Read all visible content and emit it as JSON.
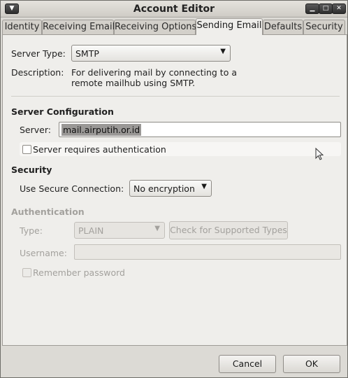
{
  "window": {
    "title": "Account Editor"
  },
  "tabs": [
    {
      "label": "Identity",
      "active": false
    },
    {
      "label": "Receiving Email",
      "active": false
    },
    {
      "label": "Receiving Options",
      "active": false
    },
    {
      "label": "Sending Email",
      "active": true
    },
    {
      "label": "Defaults",
      "active": false
    },
    {
      "label": "Security",
      "active": false
    }
  ],
  "server_type": {
    "label": "Server Type:",
    "value": "SMTP"
  },
  "description": {
    "label": "Description:",
    "line1": "For delivering mail by connecting to a",
    "line2": "remote mailhub using SMTP."
  },
  "server_config": {
    "heading": "Server Configuration",
    "server_label": "Server:",
    "server_value": "mail.airputih.or.id",
    "auth_checkbox_label": "Server requires authentication",
    "auth_checked": false
  },
  "security": {
    "heading": "Security",
    "secure_label": "Use Secure Connection:",
    "secure_value": "No encryption"
  },
  "authentication": {
    "heading": "Authentication",
    "type_label": "Type:",
    "type_value": "PLAIN",
    "check_types_label": "Check for Supported Types",
    "username_label": "Username:",
    "username_value": "",
    "remember_label": "Remember password",
    "remember_checked": false
  },
  "buttons": {
    "cancel": "Cancel",
    "ok": "OK"
  },
  "icons": {
    "window_menu": "window-menu-icon",
    "minimize": "minimize-icon",
    "maximize": "maximize-icon",
    "close": "close-icon",
    "dropdown": "chevron-down-icon",
    "cursor": "mouse-pointer-icon"
  }
}
